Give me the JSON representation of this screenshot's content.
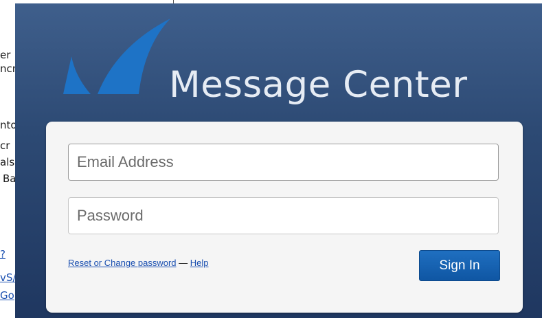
{
  "background_page": {
    "fragments": [
      "er",
      "ncr",
      "nto",
      "cr",
      "als",
      "Ba"
    ],
    "links": [
      "?",
      "vS/",
      "Go"
    ]
  },
  "brand": {
    "logo_icon": "shark-fin-logo-icon",
    "title": "Message Center",
    "colors": {
      "panel": "#2d4a74",
      "logo": "#1e73c6",
      "title": "#e6ecf4"
    }
  },
  "login": {
    "email": {
      "placeholder": "Email Address",
      "value": ""
    },
    "password": {
      "placeholder": "Password",
      "value": ""
    },
    "reset_link": "Reset or Change password",
    "separator": "—",
    "help_link": "Help",
    "signin_label": "Sign In",
    "button_color": "#0f56a3"
  }
}
